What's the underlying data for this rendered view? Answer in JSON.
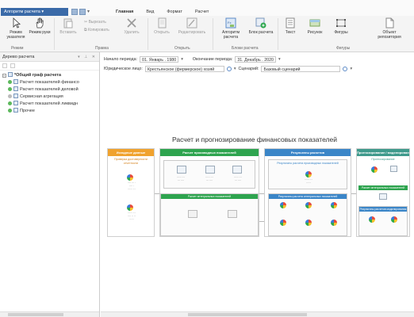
{
  "titlebar": {
    "app_menu": "Алгоритм расчета ▾",
    "tabs": [
      "Главная",
      "Вид",
      "Формат",
      "Расчет"
    ]
  },
  "ribbon": {
    "buttons": [
      {
        "label": "Режим указателя",
        "icon": "pointer-icon"
      },
      {
        "label": "Режим руки",
        "icon": "hand-icon"
      },
      {
        "label": "Вставить",
        "icon": "paste-icon"
      },
      {
        "label": "Удалить",
        "icon": "delete-icon"
      },
      {
        "label": "Открыть",
        "icon": "open-icon"
      },
      {
        "label": "Редактировать",
        "icon": "edit-icon"
      },
      {
        "label": "Алгоритм расчета",
        "icon": "algorithm-icon"
      },
      {
        "label": "Блок расчета",
        "icon": "calc-block-icon"
      },
      {
        "label": "Текст",
        "icon": "text-icon"
      },
      {
        "label": "Рисунок",
        "icon": "image-icon"
      },
      {
        "label": "Фигуры",
        "icon": "shapes-icon"
      },
      {
        "label": "Объект репозитория",
        "icon": "repository-object-icon"
      }
    ],
    "small": {
      "cut": "Вырезать",
      "copy": "Копировать"
    },
    "groups": [
      "Режим",
      "Правка",
      "Открыть",
      "Блоки расчета",
      "Фигуры"
    ]
  },
  "left_panel": {
    "title": "Дерево расчета",
    "tree": [
      {
        "label": "*Общий граф расчета",
        "root": true
      },
      {
        "label": "Расчет показателей финансо",
        "status": "green"
      },
      {
        "label": "Расчет показателей деловой",
        "status": "green"
      },
      {
        "label": "Сервисная агрегация",
        "status": "grey"
      },
      {
        "label": "Расчет показателей ликвидн",
        "status": "green"
      },
      {
        "label": "Прочее",
        "status": "green"
      }
    ]
  },
  "params": {
    "start_label": "Начало периода:",
    "start_value": "01. Январь . 1980",
    "end_label": "Окончание периода:",
    "end_value": "31. Декабрь . 2020",
    "entity_label": "Юридическое лицо:",
    "entity_value": "Крестьянское (фермерское) хозяй",
    "scenario_label": "Сценарий:",
    "scenario_value": "Базовый сценарий"
  },
  "diagram": {
    "title": "Расчет и прогнозирование финансовых показателей",
    "columns": [
      {
        "header": "Исходные данные",
        "sub": "Проверка достоверности отчетности"
      },
      {
        "header": "Расчет производных показателей",
        "sub": ""
      },
      {
        "header": "Результаты расчетов",
        "sub": "Результаты расчета производных показателей"
      },
      {
        "header": "Прогнозирование / моделирование",
        "sub": "Прогнозирование"
      }
    ],
    "inner": [
      {
        "header": "Расчет интегральных показателей"
      },
      {
        "header": "Результаты расчета интегральных показателей"
      },
      {
        "header": "Расчет интегральных показателей"
      },
      {
        "header": "Результаты расчетов моделирования"
      }
    ],
    "colors": {
      "orange": "#f0a22e",
      "green": "#2ea44f",
      "blue": "#3b86c8",
      "teal": "#3f9a8c"
    }
  }
}
